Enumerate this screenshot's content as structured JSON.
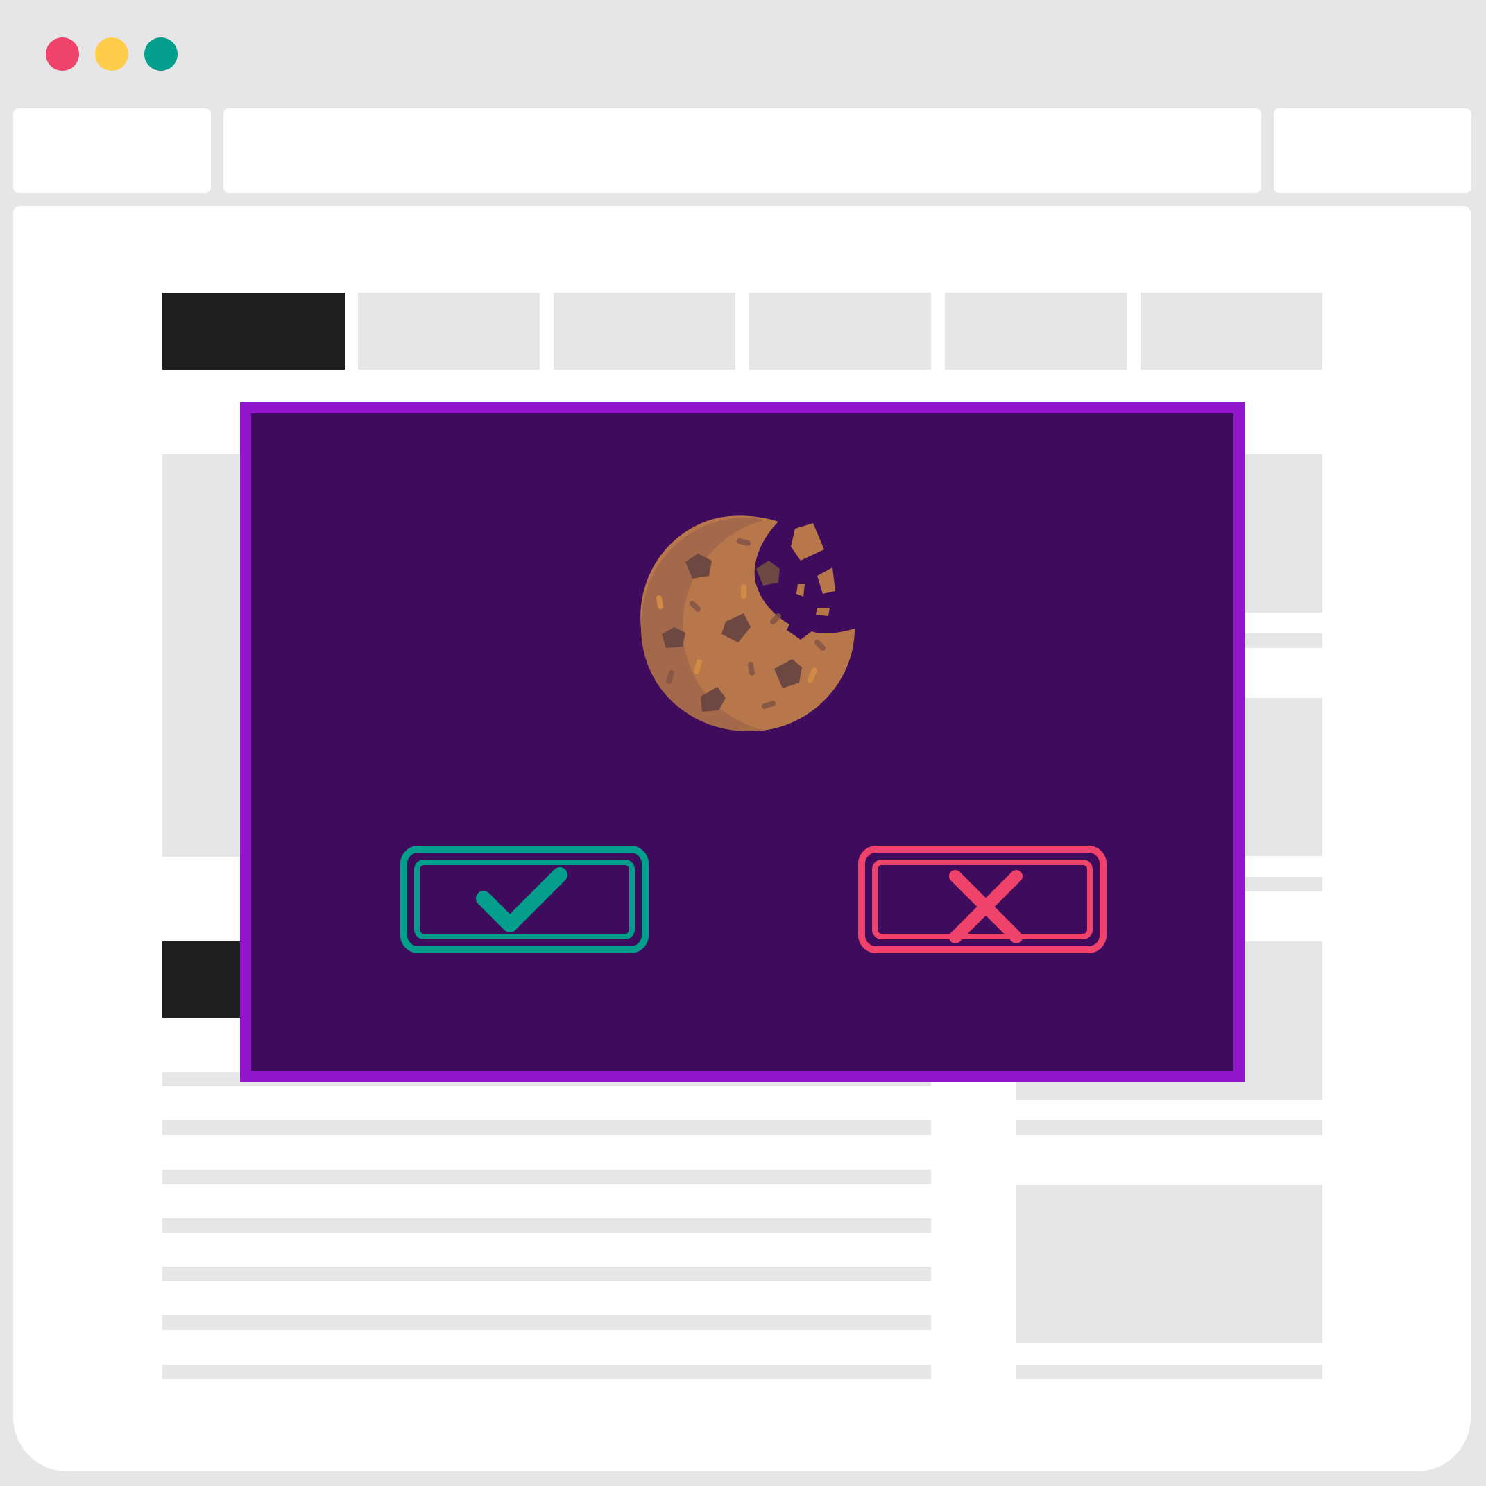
{
  "window": {
    "controls": [
      {
        "name": "close",
        "color": "#f0436c"
      },
      {
        "name": "minimize",
        "color": "#ffcd4a"
      },
      {
        "name": "maximize",
        "color": "#039e8c"
      }
    ]
  },
  "colors": {
    "background": "#e6e6e6",
    "panel": "#ffffff",
    "placeholder": "#e6e6e6",
    "dark_block": "#1e1e1e",
    "modal_background": "#3f0b5c",
    "modal_border": "#9217cc",
    "accept": "#039e8c",
    "decline": "#f0436c",
    "cookie_body": "#b8774b",
    "cookie_shadow": "#a4684a",
    "cookie_chip": "#6d4741",
    "cookie_crumb": "#d08a45"
  },
  "cookie_consent": {
    "icon": "cookie-icon",
    "accept_icon": "checkmark-icon",
    "decline_icon": "x-icon"
  }
}
